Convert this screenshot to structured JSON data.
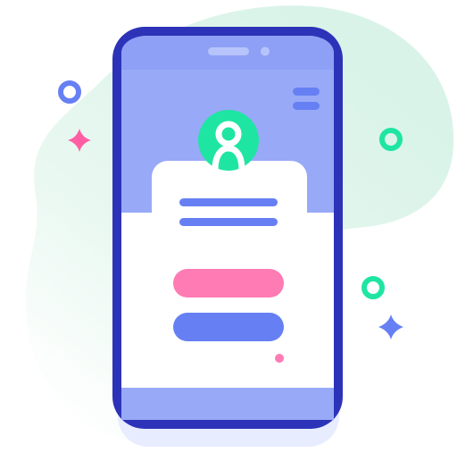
{
  "illustration": {
    "subject": "mobile-login-screen",
    "colors": {
      "blob": "#d9f3e8",
      "blob_fade": "#ffffff",
      "phone_frame": "#2d33b8",
      "phone_screen_top": "#98a9f7",
      "phone_screen_bottom": "#98a9f7",
      "phone_content": "#ffffff",
      "speaker": "#b7c4fb",
      "accent_green": "#1fe5a3",
      "accent_pink": "#ff7bb3",
      "accent_blue": "#6680f4",
      "text_lines": "#6680f4",
      "shadow": "#e8ecff"
    },
    "icons": {
      "menu": "hamburger-menu-icon",
      "avatar": "user-avatar-icon",
      "sparkle_left": "plus-sparkle-icon",
      "sparkle_right": "plus-sparkle-icon",
      "ring": "ring-dot-icon"
    },
    "form": {
      "text_line_count": 2,
      "pink_button": "login-button",
      "blue_button": "signup-button"
    }
  }
}
